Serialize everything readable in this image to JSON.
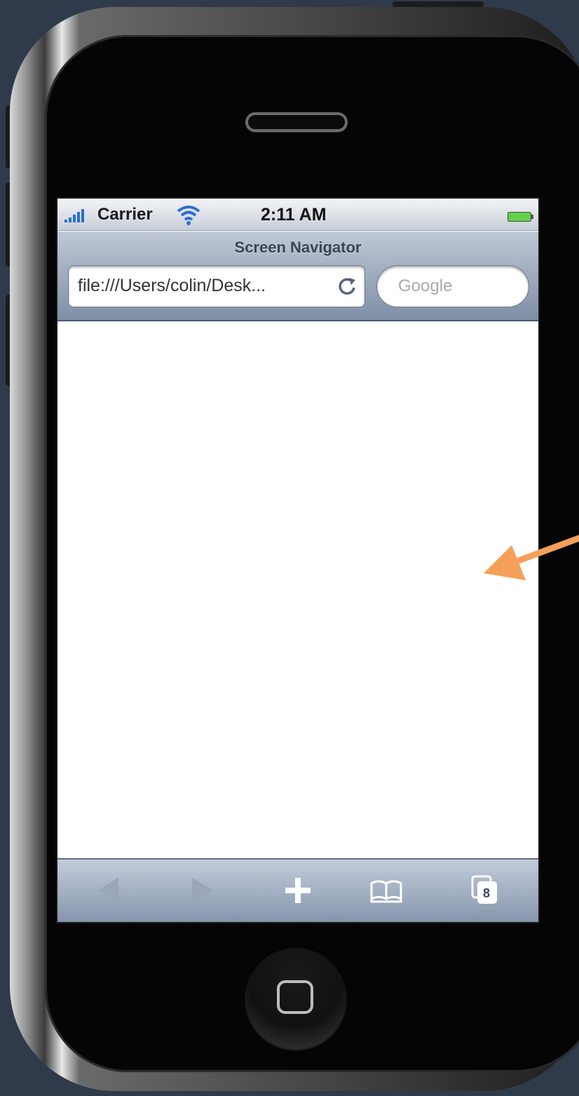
{
  "status_bar": {
    "carrier": "Carrier",
    "time": "2:11 AM",
    "icons": [
      "signal-bars-icon",
      "wifi-icon",
      "battery-icon"
    ]
  },
  "navigation": {
    "title": "Screen Navigator",
    "url": "file:///Users/colin/Desk...",
    "search_placeholder": "Google"
  },
  "toolbar": {
    "items": [
      "back-arrow-icon",
      "forward-arrow-icon",
      "add-plus-icon",
      "bookmarks-book-icon",
      "pages-icon"
    ],
    "pages_count": "8"
  },
  "colors": {
    "annotation_arrow": "#f5a05a",
    "toolbar_gradient_top": "#c3ccda",
    "toolbar_gradient_bottom": "#8494ab",
    "battery": "#5fd14b"
  }
}
